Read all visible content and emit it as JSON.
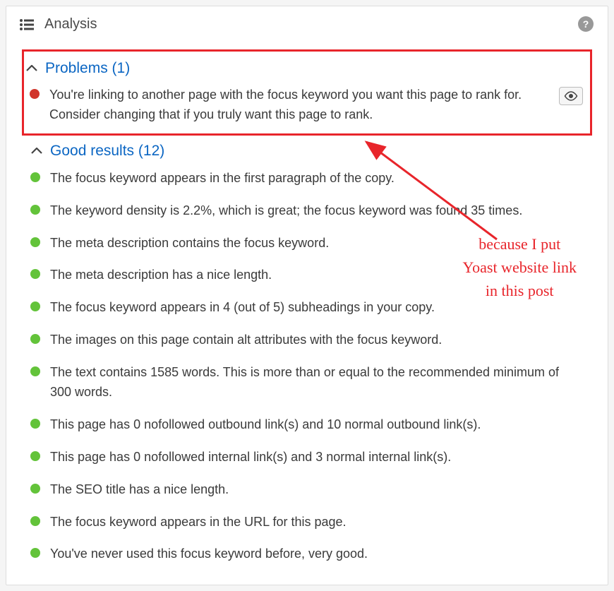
{
  "panel": {
    "title": "Analysis"
  },
  "problems": {
    "header": "Problems (1)",
    "items": [
      {
        "text": "You're linking to another page with the focus keyword you want this page to rank for. Consider changing that if you truly want this page to rank."
      }
    ]
  },
  "good": {
    "header": "Good results (12)",
    "items": [
      {
        "text": "The focus keyword appears in the first paragraph of the copy."
      },
      {
        "text": "The keyword density is 2.2%, which is great; the focus keyword was found 35 times."
      },
      {
        "text": "The meta description contains the focus keyword."
      },
      {
        "text": "The meta description has a nice length."
      },
      {
        "text": "The focus keyword appears in 4 (out of 5) subheadings in your copy."
      },
      {
        "text": "The images on this page contain alt attributes with the focus keyword."
      },
      {
        "text": "The text contains 1585 words. This is more than or equal to the recommended minimum of 300 words."
      },
      {
        "text": "This page has 0 nofollowed outbound link(s) and 10 normal outbound link(s)."
      },
      {
        "text": "This page has 0 nofollowed internal link(s) and 3 normal internal link(s)."
      },
      {
        "text": "The SEO title has a nice length."
      },
      {
        "text": "The focus keyword appears in the URL for this page."
      },
      {
        "text": "You've never used this focus keyword before, very good."
      }
    ]
  },
  "annotation": {
    "line1": "because I put",
    "line2": "Yoast website link",
    "line3": "in this post"
  }
}
